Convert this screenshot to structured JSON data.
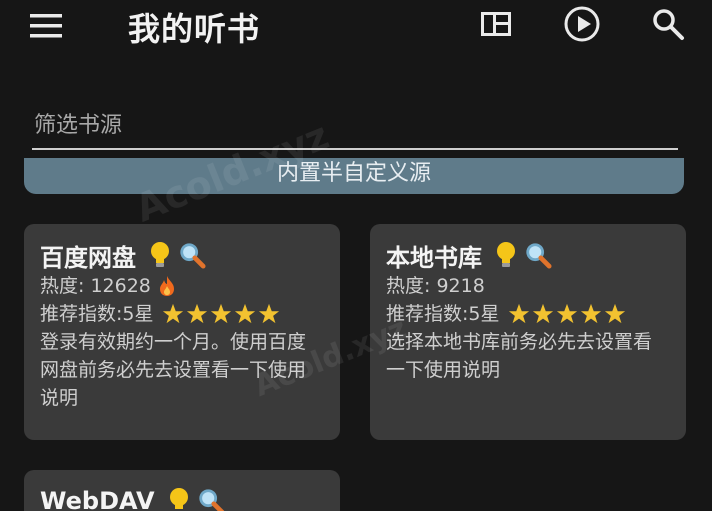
{
  "app_bar": {
    "title": "我的听书",
    "menu_icon": "menu-icon",
    "actions": [
      "layout-icon",
      "play-circle-icon",
      "search-icon"
    ]
  },
  "filter": {
    "placeholder": "筛选书源",
    "value": ""
  },
  "source_group": {
    "label": "内置半自定义源"
  },
  "cards": [
    {
      "name": "百度网盘",
      "heat_label": "热度: 12628",
      "has_fire": true,
      "rating_label": "推荐指数:5星",
      "stars": 5,
      "description": "登录有效期约一个月。使用百度网盘前务必先去设置看一下使用说明"
    },
    {
      "name": "本地书库",
      "heat_label": "热度: 9218",
      "has_fire": false,
      "rating_label": "推荐指数:5星",
      "stars": 5,
      "description": "选择本地书库前务必先去设置看一下使用说明"
    },
    {
      "name": "WebDAV"
    }
  ],
  "watermark": "Acold.xyz",
  "colors": {
    "background": "#161616",
    "card": "#3a3a3a",
    "group_bar": "#5f7b8a",
    "star": "#f2c230",
    "fire": "#f06a1d",
    "bulb": "#f5c518"
  }
}
